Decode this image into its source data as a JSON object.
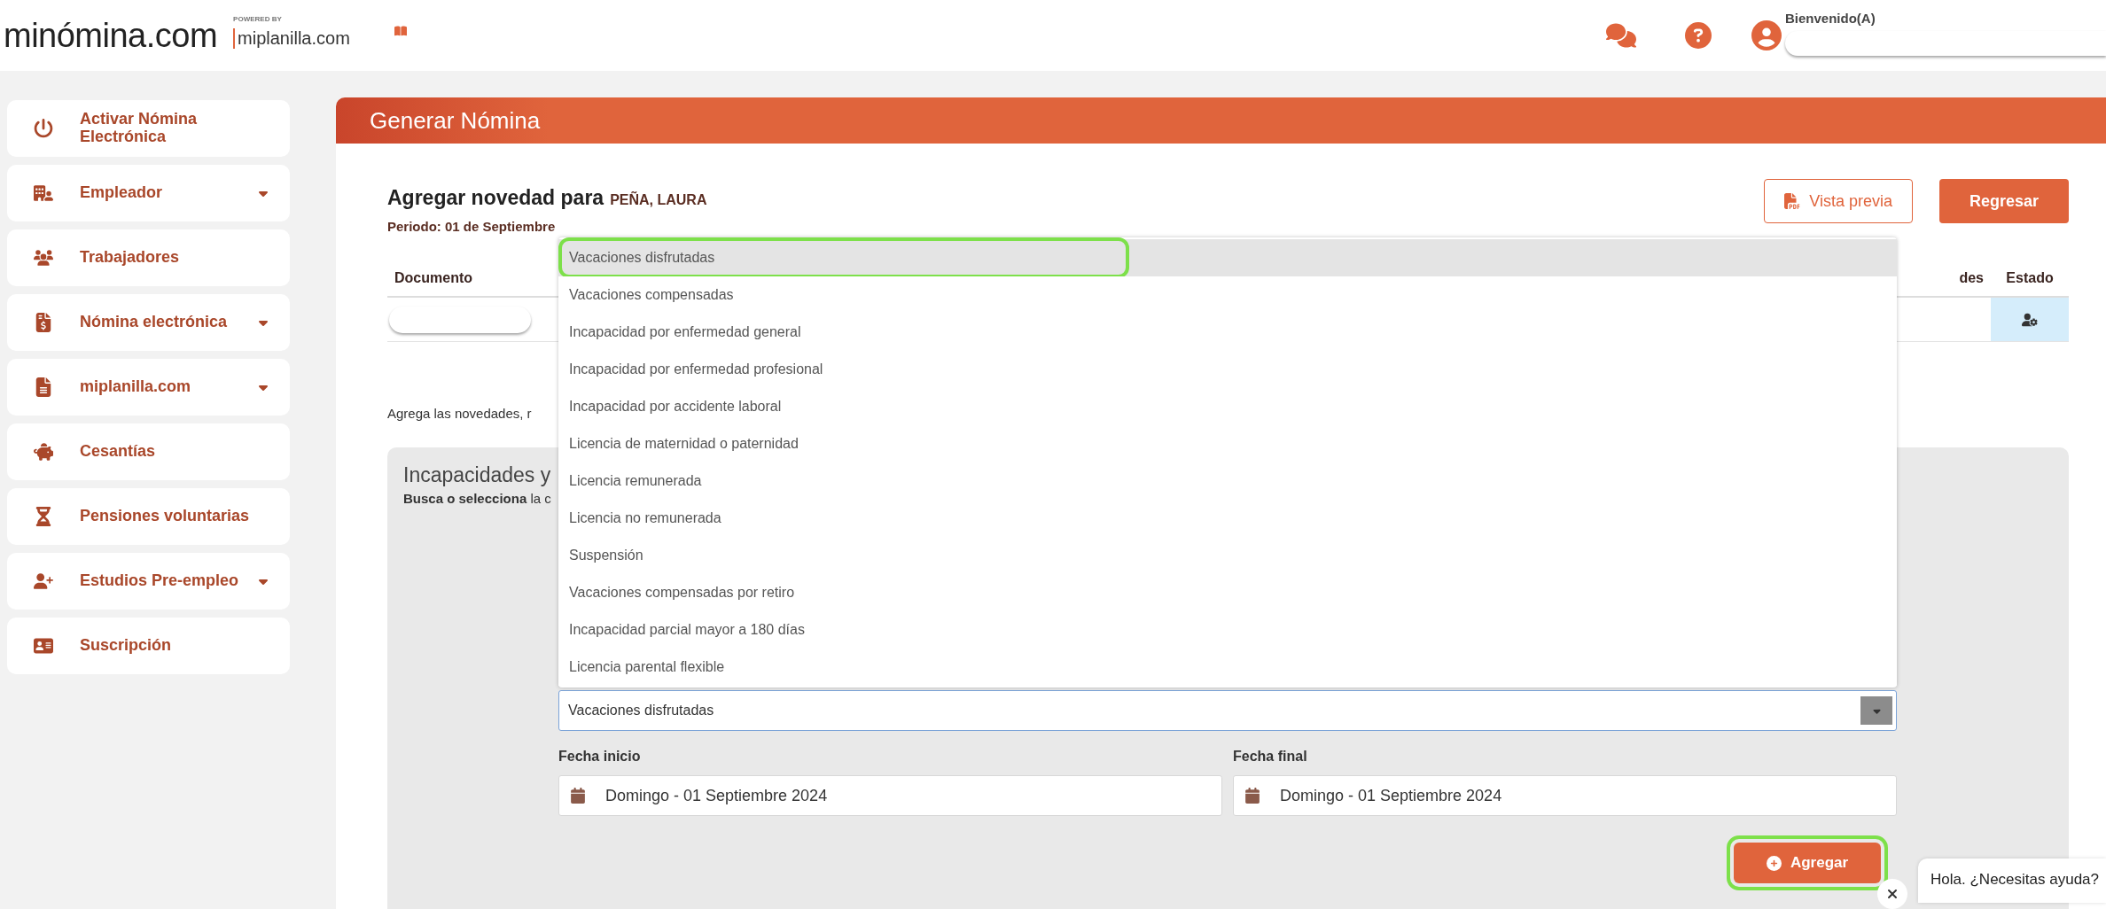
{
  "header": {
    "logo": "minómina.com",
    "powered_by": "POWERED BY",
    "partner": "miplanilla.com",
    "greeting": "Bienvenido(A)"
  },
  "sidebar": {
    "items": [
      {
        "label": "Activar Nómina Electrónica",
        "has_submenu": false
      },
      {
        "label": "Empleador",
        "has_submenu": true
      },
      {
        "label": "Trabajadores",
        "has_submenu": false
      },
      {
        "label": "Nómina electrónica",
        "has_submenu": true
      },
      {
        "label": "miplanilla.com",
        "has_submenu": true
      },
      {
        "label": "Cesantías",
        "has_submenu": false
      },
      {
        "label": "Pensiones voluntarias",
        "has_submenu": false
      },
      {
        "label": "Estudios Pre-empleo",
        "has_submenu": true
      },
      {
        "label": "Suscripción",
        "has_submenu": false
      }
    ]
  },
  "page": {
    "title": "Generar Nómina",
    "heading": "Agregar novedad para",
    "employee": "PEÑA, LAURA",
    "period": "Periodo: 01 de Septiembre",
    "buttons": [
      {
        "label": "Vista previa",
        "kind": "outline"
      },
      {
        "label": "Regresar",
        "kind": "solid"
      }
    ]
  },
  "table": {
    "columns": [
      "Documento",
      "des",
      "Estado"
    ]
  },
  "hint": "Agrega las novedades, r",
  "section": {
    "title": "Incapacidades y",
    "hint_bold": "Busca o selecciona",
    "hint_rest": "la c",
    "dropdown": {
      "options": [
        {
          "label": "Vacaciones disfrutadas",
          "selected": true,
          "highlighted": true
        },
        {
          "label": "Vacaciones compensadas",
          "selected": false,
          "highlighted": false
        },
        {
          "label": "Incapacidad por enfermedad general",
          "selected": false,
          "highlighted": false
        },
        {
          "label": "Incapacidad por enfermedad profesional",
          "selected": false,
          "highlighted": false
        },
        {
          "label": "Incapacidad por accidente laboral",
          "selected": false,
          "highlighted": false
        },
        {
          "label": "Licencia de maternidad o paternidad",
          "selected": false,
          "highlighted": false
        },
        {
          "label": "Licencia remunerada",
          "selected": false,
          "highlighted": false
        },
        {
          "label": "Licencia no remunerada",
          "selected": false,
          "highlighted": false
        },
        {
          "label": "Suspensión",
          "selected": false,
          "highlighted": false
        },
        {
          "label": "Vacaciones compensadas por retiro",
          "selected": false,
          "highlighted": false
        },
        {
          "label": "Incapacidad parcial mayor a 180 días",
          "selected": false,
          "highlighted": false
        },
        {
          "label": "Licencia parental flexible",
          "selected": false,
          "highlighted": false
        }
      ]
    },
    "select_value": "Vacaciones disfrutadas",
    "dates": [
      {
        "label": "Fecha inicio",
        "value": "Domingo - 01 Septiembre 2024"
      },
      {
        "label": "Fecha final",
        "value": "Domingo - 01 Septiembre 2024"
      }
    ],
    "submit": {
      "label": "Agregar",
      "highlighted": true
    }
  },
  "chat": {
    "message": "Hola. ¿Necesitas ayuda?"
  }
}
